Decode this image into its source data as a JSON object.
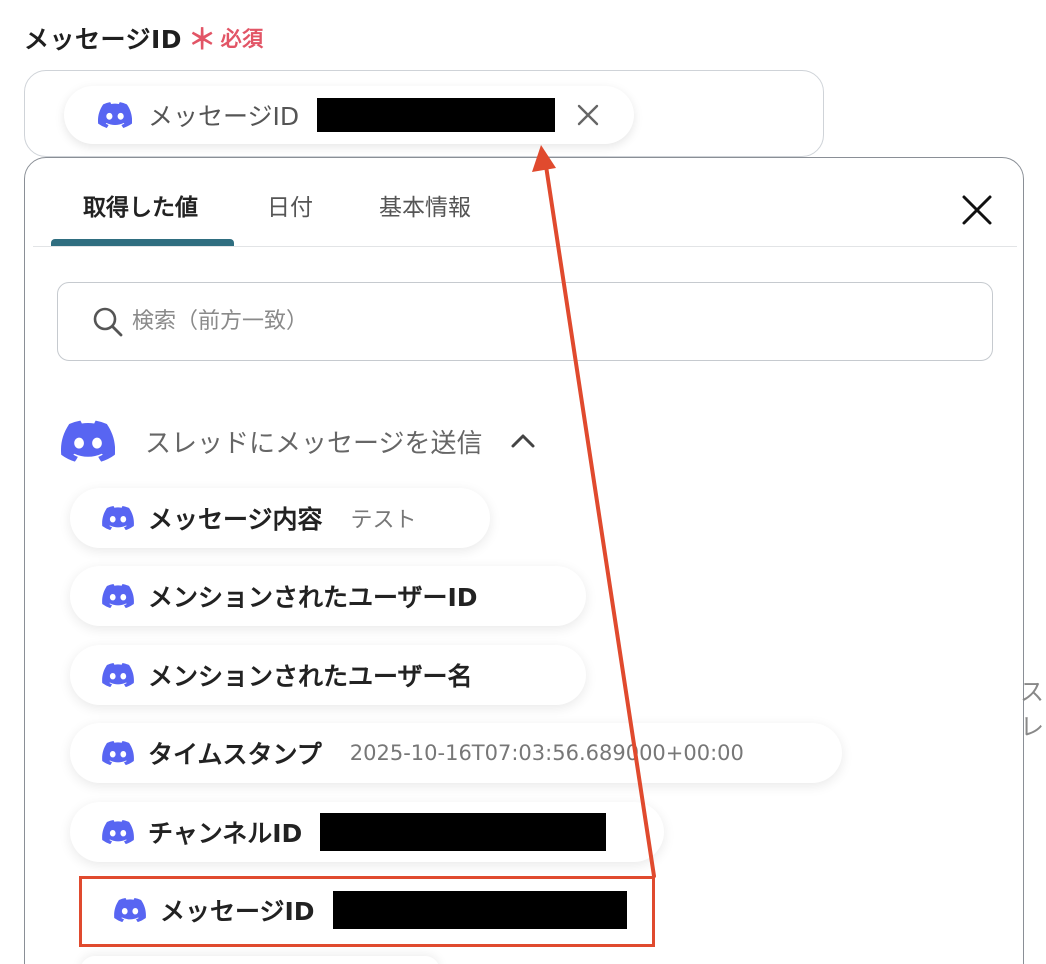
{
  "field": {
    "label": "メッセージID",
    "required_star": "＊",
    "required_text": "必須",
    "chip_label": "メッセージID",
    "chip_icon": "discord-icon"
  },
  "panel": {
    "tabs": [
      {
        "label": "取得した値",
        "active": true
      },
      {
        "label": "日付",
        "active": false
      },
      {
        "label": "基本情報",
        "active": false
      }
    ],
    "search": {
      "placeholder": "検索（前方一致）"
    },
    "section": {
      "title": "スレッドにメッセージを送信",
      "expanded": true
    },
    "items": [
      {
        "label": "メッセージ内容",
        "value": "テスト",
        "redacted": false
      },
      {
        "label": "メンションされたユーザーID",
        "value": "",
        "redacted": false
      },
      {
        "label": "メンションされたユーザー名",
        "value": "",
        "redacted": false
      },
      {
        "label": "タイムスタンプ",
        "value": "2025-10-16T07:03:56.689000+00:00",
        "redacted": false
      },
      {
        "label": "チャンネルID",
        "value": "",
        "redacted": true
      },
      {
        "label": "メッセージID",
        "value": "",
        "redacted": true
      }
    ]
  },
  "background_text": "スレ",
  "colors": {
    "discord": "#5865F2",
    "required": "#e25566",
    "tab_accent": "#2f6e80",
    "annotation": "#e04a2e"
  }
}
